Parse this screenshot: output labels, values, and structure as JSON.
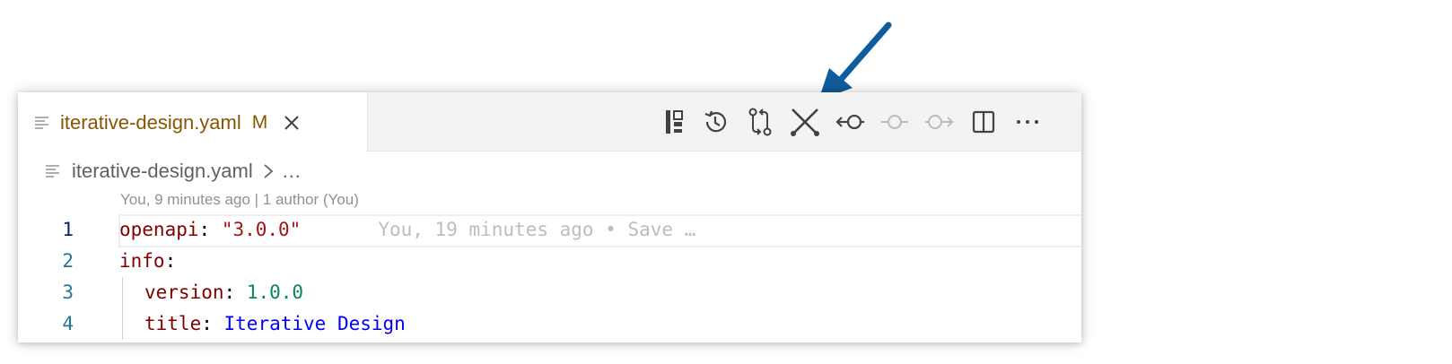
{
  "tab": {
    "title": "iterative-design.yaml",
    "badge": "M"
  },
  "toolbar": {
    "icons": [
      "gitlens-inspect-icon",
      "file-history-icon",
      "compare-changes-icon",
      "toggle-merge-icon",
      "open-previous-revision-icon",
      "open-revision-icon",
      "open-next-revision-icon",
      "split-editor-icon",
      "more-actions-icon"
    ]
  },
  "breadcrumb": {
    "file": "iterative-design.yaml",
    "more": "…"
  },
  "codelens": "You, 9 minutes ago | 1 author (You)",
  "lines": [
    {
      "num": "1",
      "key": "openapi",
      "colon": ": ",
      "value": "\"3.0.0\"",
      "blame": "You, 19 minutes ago • Save …"
    },
    {
      "num": "2",
      "key": "info",
      "colon": ":"
    },
    {
      "num": "3",
      "key": "version",
      "colon": ": ",
      "value": "1.0.0"
    },
    {
      "num": "4",
      "key": "title",
      "colon": ": ",
      "value": "Iterative Design"
    }
  ],
  "colors": {
    "modified_tab": "#895503",
    "arrow": "#0e5c9c",
    "yaml_key": "#800000",
    "yaml_string": "#a31515",
    "yaml_number": "#098658",
    "yaml_value": "#0000ff"
  }
}
